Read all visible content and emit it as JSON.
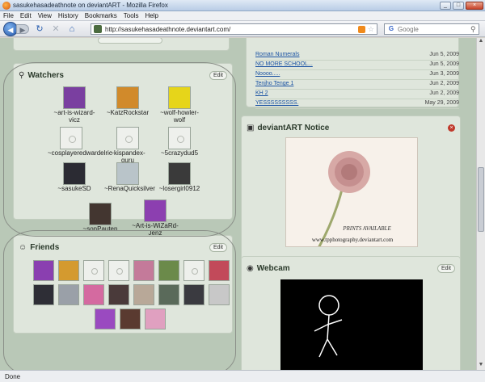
{
  "window": {
    "title": "sasukehasadeathnote on deviantART - Mozilla Firefox"
  },
  "menu": [
    "File",
    "Edit",
    "View",
    "History",
    "Bookmarks",
    "Tools",
    "Help"
  ],
  "address": {
    "url": "http://sasukehasadeathnote.deviantart.com/"
  },
  "search": {
    "placeholder": "Google"
  },
  "status": {
    "text": "Done"
  },
  "journal": [
    {
      "title": "Roman Numerals",
      "date": "Jun 5, 2009"
    },
    {
      "title": "NO MORE SCHOOL...",
      "date": "Jun 5, 2009"
    },
    {
      "title": "Noooo.....",
      "date": "Jun 3, 2009"
    },
    {
      "title": "Tenjho Tenge 1",
      "date": "Jun 2, 2009"
    },
    {
      "title": "KH 2",
      "date": "Jun 2, 2009"
    },
    {
      "title": "YESSSSSSSSS.",
      "date": "May 29, 2009"
    }
  ],
  "watchers": {
    "title": "Watchers",
    "edit": "Edit",
    "users": [
      {
        "name": "~art-is-wizard-vicz",
        "avatar": "#7a3fa0"
      },
      {
        "name": "~KatzRockstar",
        "avatar": "#d18a2b"
      },
      {
        "name": "~wolf-howler-wolf",
        "avatar": "#e6d51a"
      },
      {
        "name": "~cosplayeredwardelric",
        "avatar": ""
      },
      {
        "name": "~kispandex-guru",
        "avatar": ""
      },
      {
        "name": "~5crazydud5",
        "avatar": ""
      },
      {
        "name": "~sasukeSD",
        "avatar": "#2b2b33"
      },
      {
        "name": "~RenaQuicksilver",
        "avatar": "#b9c4c9"
      },
      {
        "name": "~losergirl0912",
        "avatar": "#3a3a3a"
      },
      {
        "name": "~sonPauten",
        "avatar": "#433630"
      },
      {
        "name": "~Art-is-WiZaRd-Jenz",
        "avatar": "#8c3fb0"
      }
    ]
  },
  "friends": {
    "title": "Friends",
    "edit": "Edit",
    "avatars": [
      "#8a3fb0",
      "#d49a2f",
      "",
      "",
      "#c47a9a",
      "#6b8a4a",
      "",
      "#c24a5a",
      "#2e2e36",
      "#9aa0a8",
      "#d46aa0",
      "#4a3a3a",
      "#b8a898",
      "#5a6a5a",
      "#3a3a40",
      "#c8c8c8",
      "#9a4ac0",
      "#5a3a30",
      "#e0a0c0"
    ]
  },
  "notice": {
    "title": "deviantART Notice",
    "caption": "PRINTS AVAILABLE",
    "site": "www.tpphotography.deviantart.com"
  },
  "webcam": {
    "title": "Webcam",
    "edit": "Edit"
  },
  "colors": {
    "accent": "#1b53a3",
    "panel": "#dfe6dc",
    "page": "#b9c8b7"
  }
}
